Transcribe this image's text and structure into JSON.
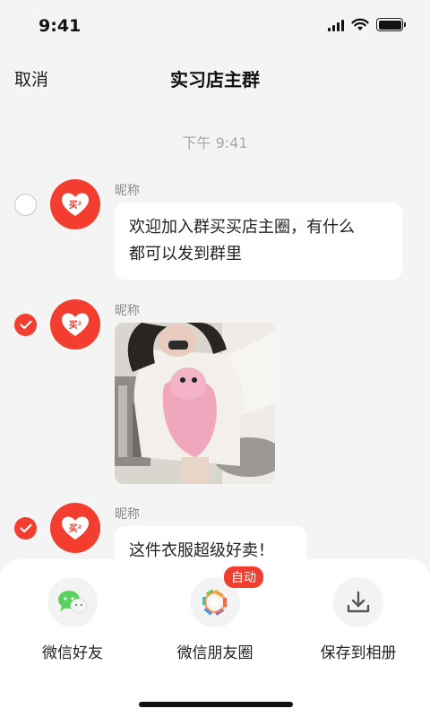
{
  "status_bar": {
    "time": "9:41"
  },
  "nav": {
    "cancel_label": "取消",
    "title": "实习店主群"
  },
  "chat": {
    "time_divider": "下午 9:41",
    "avatar_mark": "买²",
    "messages": [
      {
        "sender": "昵称",
        "text_line1": "欢迎加入群买买店主圈，有什么",
        "text_line2": "都可以发到群里",
        "selected": false
      },
      {
        "sender": "昵称",
        "type": "image",
        "selected": true
      },
      {
        "sender": "昵称",
        "text": "这件衣服超级好卖！",
        "selected": true
      }
    ]
  },
  "share_sheet": {
    "items": [
      {
        "label": "微信好友",
        "icon": "wechat-icon"
      },
      {
        "label": "微信朋友圈",
        "icon": "moments-icon",
        "badge": "自动"
      },
      {
        "label": "保存到相册",
        "icon": "download-icon"
      }
    ]
  },
  "colors": {
    "accent": "#f23d2f",
    "wechat_green": "#5bd15e",
    "background": "#f4f4f4"
  }
}
